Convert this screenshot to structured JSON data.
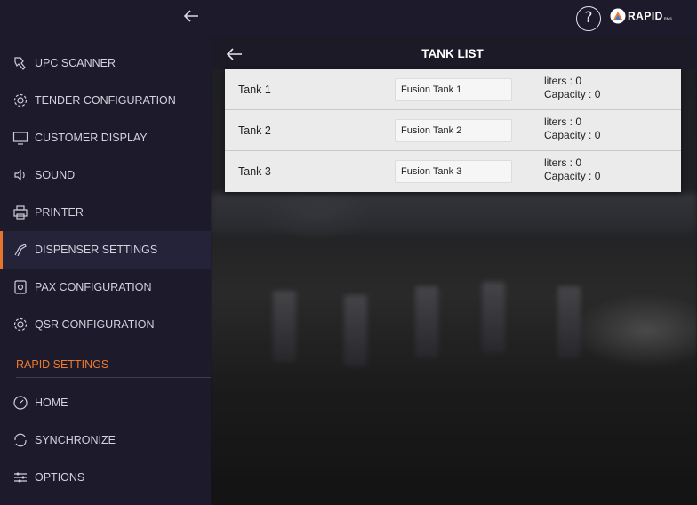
{
  "header": {
    "help_label": "?",
    "logo_text": "RAPID",
    "logo_sub": "RMS"
  },
  "sidebar": {
    "items": [
      {
        "label": "UPC SCANNER",
        "icon": "scanner-icon"
      },
      {
        "label": "TENDER CONFIGURATION",
        "icon": "gear-icon"
      },
      {
        "label": "CUSTOMER DISPLAY",
        "icon": "monitor-icon"
      },
      {
        "label": "SOUND",
        "icon": "speaker-icon"
      },
      {
        "label": "PRINTER",
        "icon": "printer-icon"
      },
      {
        "label": "DISPENSER SETTINGS",
        "icon": "fuel-nozzle-icon",
        "active": true
      },
      {
        "label": "PAX CONFIGURATION",
        "icon": "pax-terminal-icon"
      },
      {
        "label": "QSR CONFIGURATION",
        "icon": "gear-icon"
      }
    ],
    "section_label": "RAPID SETTINGS",
    "section_items": [
      {
        "label": "HOME",
        "icon": "home-icon"
      },
      {
        "label": "SYNCHRONIZE",
        "icon": "sync-icon"
      },
      {
        "label": "OPTIONS",
        "icon": "sliders-icon"
      }
    ]
  },
  "panel": {
    "title": "TANK LIST",
    "tanks": [
      {
        "name": "Tank 1",
        "field_value": "Fusion Tank 1",
        "liters": "liters : 0",
        "capacity": "Capacity : 0"
      },
      {
        "name": "Tank 2",
        "field_value": "Fusion Tank 2",
        "liters": "liters : 0",
        "capacity": "Capacity : 0"
      },
      {
        "name": "Tank 3",
        "field_value": "Fusion Tank 3",
        "liters": "liters : 0",
        "capacity": "Capacity : 0"
      }
    ]
  },
  "colors": {
    "background": "#1d1a2c",
    "accent": "#ef7a2c",
    "active_item_bg": "#25233a",
    "panel_bg": "#ebebeb"
  }
}
